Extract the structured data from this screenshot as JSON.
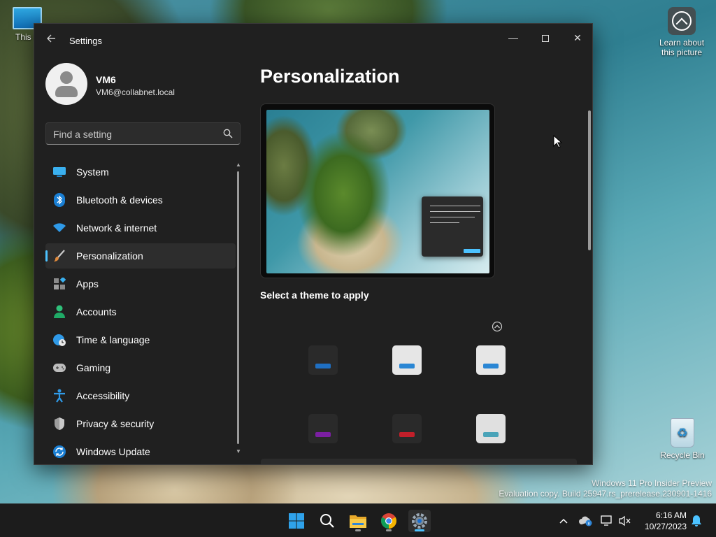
{
  "desktop": {
    "icons": {
      "this_pc": "This P",
      "learn_picture": "Learn about\nthis picture",
      "recycle_bin": "Recycle Bin"
    },
    "watermark": {
      "line1": "Windows 11 Pro Insider Preview",
      "line2": "Evaluation copy. Build 25947.rs_prerelease.230901-1416"
    }
  },
  "window": {
    "title": "Settings",
    "controls": {
      "minimize": "—",
      "close": "✕"
    },
    "profile": {
      "name": "VM6",
      "email": "VM6@collabnet.local"
    },
    "search": {
      "placeholder": "Find a setting",
      "value": ""
    },
    "nav": [
      {
        "label": "System",
        "icon": "system-icon",
        "selected": false
      },
      {
        "label": "Bluetooth & devices",
        "icon": "bluetooth-icon",
        "selected": false
      },
      {
        "label": "Network & internet",
        "icon": "wifi-icon",
        "selected": false
      },
      {
        "label": "Personalization",
        "icon": "brush-icon",
        "selected": true
      },
      {
        "label": "Apps",
        "icon": "apps-icon",
        "selected": false
      },
      {
        "label": "Accounts",
        "icon": "person-icon",
        "selected": false
      },
      {
        "label": "Time & language",
        "icon": "globe-clock-icon",
        "selected": false
      },
      {
        "label": "Gaming",
        "icon": "gamepad-icon",
        "selected": false
      },
      {
        "label": "Accessibility",
        "icon": "accessibility-icon",
        "selected": false
      },
      {
        "label": "Privacy & security",
        "icon": "shield-icon",
        "selected": false
      },
      {
        "label": "Windows Update",
        "icon": "update-icon",
        "selected": false
      }
    ],
    "main": {
      "title": "Personalization",
      "theme_heading": "Select a theme to apply",
      "themes": [
        {
          "name": "dark-blue",
          "bg": "#2a2a2a",
          "accent": "#1f6fc2"
        },
        {
          "name": "light-blue",
          "bg": "#e6e6e6",
          "accent": "#2a86d4"
        },
        {
          "name": "light-blue-2",
          "bg": "#e6e6e6",
          "accent": "#2a86d4"
        },
        {
          "name": "dark-purple",
          "bg": "#2a2a2a",
          "accent": "#7b1fa2"
        },
        {
          "name": "dark-red",
          "bg": "#2a2a2a",
          "accent": "#c21f2a"
        },
        {
          "name": "light-teal",
          "bg": "#e0e0e0",
          "accent": "#4aa3b8"
        }
      ]
    }
  },
  "taskbar": {
    "apps": [
      "start-icon",
      "search-icon",
      "file-explorer-icon",
      "chrome-icon",
      "settings-icon"
    ],
    "time": "6:16 AM",
    "date": "10/27/2023"
  },
  "colors": {
    "accent": "#4cc2ff",
    "window_bg": "#202020",
    "taskbar_bg": "#1c1c1c"
  }
}
